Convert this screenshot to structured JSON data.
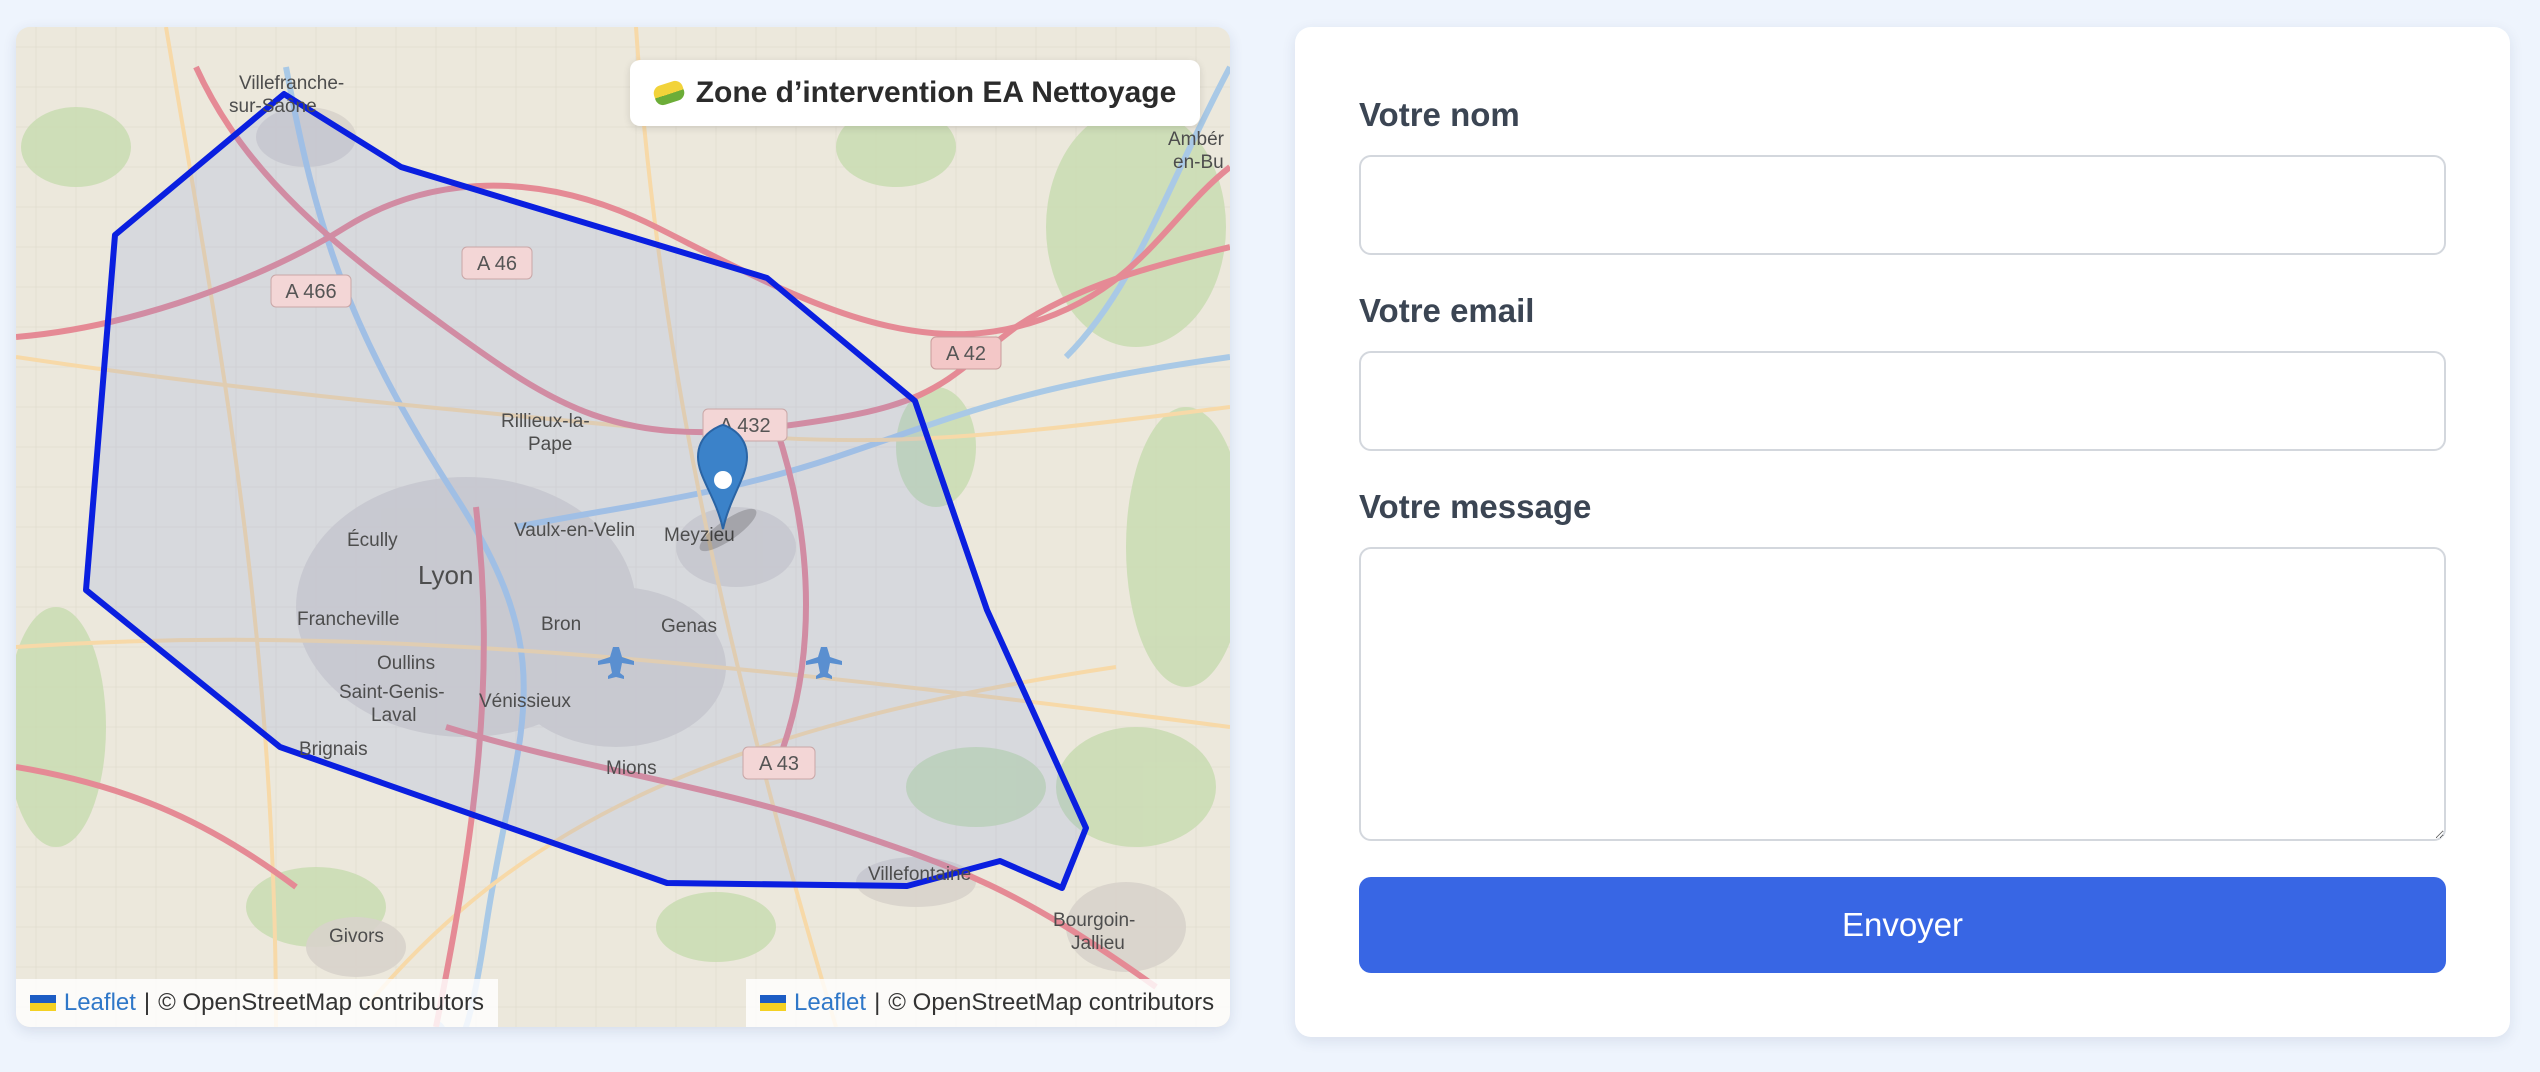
{
  "map": {
    "title": "Zone d’intervention EA Nettoyage",
    "title_icon": "sponge-icon",
    "attribution": {
      "leaflet": "Leaflet",
      "separator": "|",
      "osm": "© OpenStreetMap contributors"
    },
    "places": {
      "villefranche_1": "Villefranche-",
      "villefranche_2": "sur-Saône",
      "amberieu_1": "Ambér",
      "amberieu_2": "en-Bu",
      "rillieux_1": "Rillieux-la-",
      "rillieux_2": "Pape",
      "vaulx": "Vaulx-en-Velin",
      "meyzieu": "Meyzieu",
      "ecully": "Écully",
      "lyon": "Lyon",
      "francheville": "Francheville",
      "bron": "Bron",
      "genas": "Genas",
      "oullins": "Oullins",
      "st_genis_1": "Saint-Genis-",
      "st_genis_2": "Laval",
      "venissieux": "Vénissieux",
      "brignais": "Brignais",
      "mions": "Mions",
      "villefontaine": "Villefontaine",
      "givors": "Givors",
      "bourgoin_1": "Bourgoin-",
      "bourgoin_2": "Jallieu"
    },
    "roads": {
      "a466": "A 466",
      "a46": "A 46",
      "a42": "A 42",
      "a432": "A 432",
      "a43": "A 43"
    },
    "zone_color": "#0a1fe0",
    "marker_color": "#3b82c9"
  },
  "form": {
    "name_label": "Votre nom",
    "name_value": "",
    "email_label": "Votre email",
    "email_value": "",
    "message_label": "Votre message",
    "message_value": "",
    "submit_label": "Envoyer"
  },
  "colors": {
    "accent": "#3866e4",
    "background": "#eef4fd"
  }
}
